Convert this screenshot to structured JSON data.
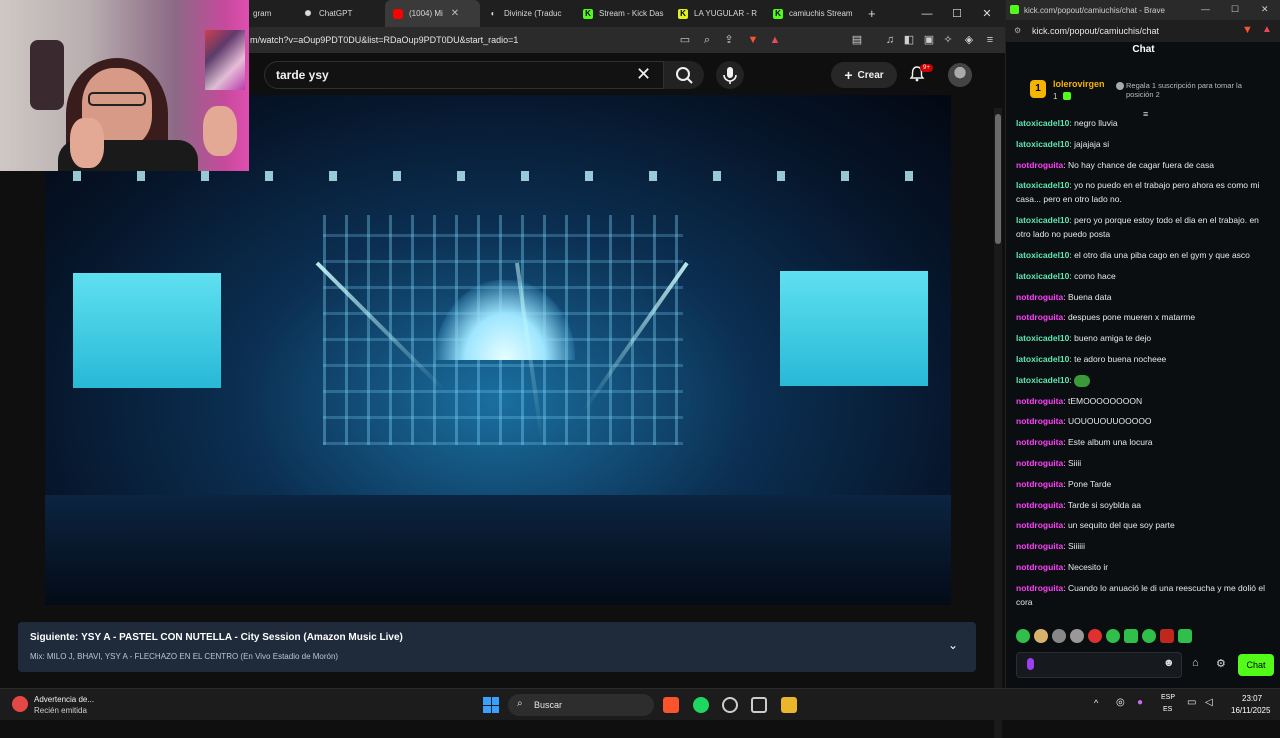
{
  "browser": {
    "tabs": [
      {
        "label": "gram",
        "icon": "instagram-icon"
      },
      {
        "label": "ChatGPT",
        "icon": "chatgpt-icon"
      },
      {
        "label": "(1004) Mi",
        "icon": "youtube-icon",
        "active": true
      },
      {
        "label": "Divinize (Traduc",
        "icon": "divinize-icon"
      },
      {
        "label": "Stream - Kick Das",
        "icon": "kick-icon"
      },
      {
        "label": "LA YUGULAR - R",
        "icon": "kick-icon"
      },
      {
        "label": "camiuchis Stream",
        "icon": "kick-icon"
      }
    ],
    "url": "m/watch?v=aOup9PDT0DU&list=RDaOup9PDT0DU&start_radio=1"
  },
  "youtube": {
    "search_value": "tarde ysy",
    "create_label": "Crear",
    "notifications_badge": "9+",
    "up_next": {
      "prefix": "Siguiente:",
      "title": "YSY A - PASTEL CON NUTELLA - City Session (Amazon Music Live)",
      "subtitle": "Mix: MILO J, BHAVI, YSY A - FLECHAZO EN EL CENTRO (En Vivo Estadio de Morón)"
    }
  },
  "kick": {
    "window_title": "kick.com/popout/camiuchis/chat - Brave",
    "url": "kick.com/popout/camiuchis/chat",
    "header": "Chat",
    "pinned": {
      "rank": "1",
      "user": "lolerovirgen",
      "count": "1",
      "note": "Regala 1 suscripción para tomar la posición 2"
    },
    "messages": [
      {
        "user": "latoxicadel10",
        "text": "negro lluvia",
        "color": "green"
      },
      {
        "user": "latoxicadel10",
        "text": "jajajaja si",
        "color": "green"
      },
      {
        "user": "notdroguita",
        "text": "No hay chance de cagar fuera de casa",
        "color": "pink"
      },
      {
        "user": "latoxicadel10",
        "text": "yo no puedo en el trabajo pero ahora es como mi casa... pero en otro lado no.",
        "color": "green"
      },
      {
        "user": "latoxicadel10",
        "text": "pero yo porque estoy todo el dia en el trabajo. en otro lado no puedo posta",
        "color": "green"
      },
      {
        "user": "latoxicadel10",
        "text": "el otro dia una piba cago en el gym y que asco",
        "color": "green"
      },
      {
        "user": "latoxicadel10",
        "text": "como hace",
        "color": "green"
      },
      {
        "user": "notdroguita",
        "text": "Buena data",
        "color": "pink"
      },
      {
        "user": "notdroguita",
        "text": "despues pone mueren x matarme",
        "color": "pink"
      },
      {
        "user": "latoxicadel10",
        "text": "bueno amiga te dejo",
        "color": "green"
      },
      {
        "user": "latoxicadel10",
        "text": "te adoro buena nocheee",
        "color": "green"
      },
      {
        "user": "latoxicadel10",
        "text": "",
        "color": "green"
      },
      {
        "user": "notdroguita",
        "text": "tEMOOOOOOOON",
        "color": "pink"
      },
      {
        "user": "notdroguita",
        "text": "UOUOUOUUOOOOO",
        "color": "pink"
      },
      {
        "user": "notdroguita",
        "text": "Este album una locura",
        "color": "pink"
      },
      {
        "user": "notdroguita",
        "text": "Siiii",
        "color": "pink"
      },
      {
        "user": "notdroguita",
        "text": "Pone Tarde",
        "color": "pink"
      },
      {
        "user": "notdroguita",
        "text": "Tarde si soyblda aa",
        "color": "pink"
      },
      {
        "user": "notdroguita",
        "text": "un sequito del que soy parte",
        "color": "pink"
      },
      {
        "user": "notdroguita",
        "text": "Siiiiii",
        "color": "pink"
      },
      {
        "user": "notdroguita",
        "text": "Necesito ir",
        "color": "pink"
      },
      {
        "user": "notdroguita",
        "text": "Cuando lo anuació le di una reescucha y me dolió el cora",
        "color": "pink"
      }
    ],
    "send_label": "Chat"
  },
  "taskbar": {
    "warning_title": "Advertencia de...",
    "warning_sub": "Recién emitida",
    "search_label": "Buscar",
    "lang_top": "ESP",
    "lang_bottom": "ES",
    "time": "23:07",
    "date": "16/11/2025"
  },
  "colors": {
    "kick_green": "#53fc18",
    "pink_user": "#ff3ff9",
    "youtube_bg": "#0f0f0f"
  }
}
